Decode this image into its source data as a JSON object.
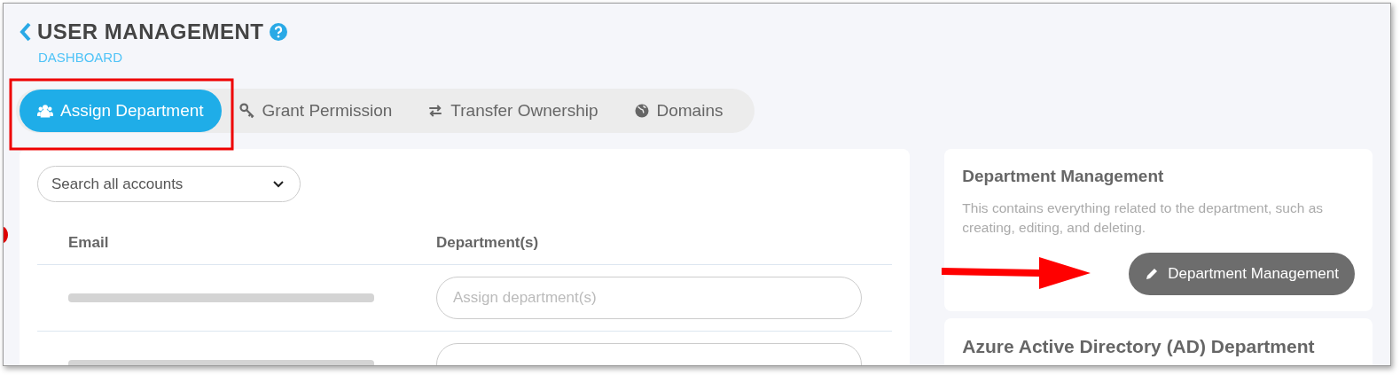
{
  "header": {
    "title": "USER MANAGEMENT",
    "breadcrumb": "DASHBOARD"
  },
  "tabs": [
    {
      "label": "Assign Department",
      "kind": "users",
      "selected": true
    },
    {
      "label": "Grant Permission",
      "kind": "key",
      "selected": false
    },
    {
      "label": "Transfer Ownership",
      "kind": "swap",
      "selected": false
    },
    {
      "label": "Domains",
      "kind": "globe",
      "selected": false
    }
  ],
  "search": {
    "value": "Search all accounts"
  },
  "table": {
    "columns": [
      "Email",
      "Department(s)"
    ],
    "rows": [
      {
        "kind": "account",
        "department_placeholder": "Assign department(s)"
      },
      {
        "kind": "account"
      }
    ]
  },
  "cards": [
    {
      "title": "Department Management",
      "description": "This contains everything related to the department, such as creating, editing, and deleting.",
      "button": "Department Management"
    },
    {
      "title": "Azure Active Directory (AD) Department"
    }
  ]
}
